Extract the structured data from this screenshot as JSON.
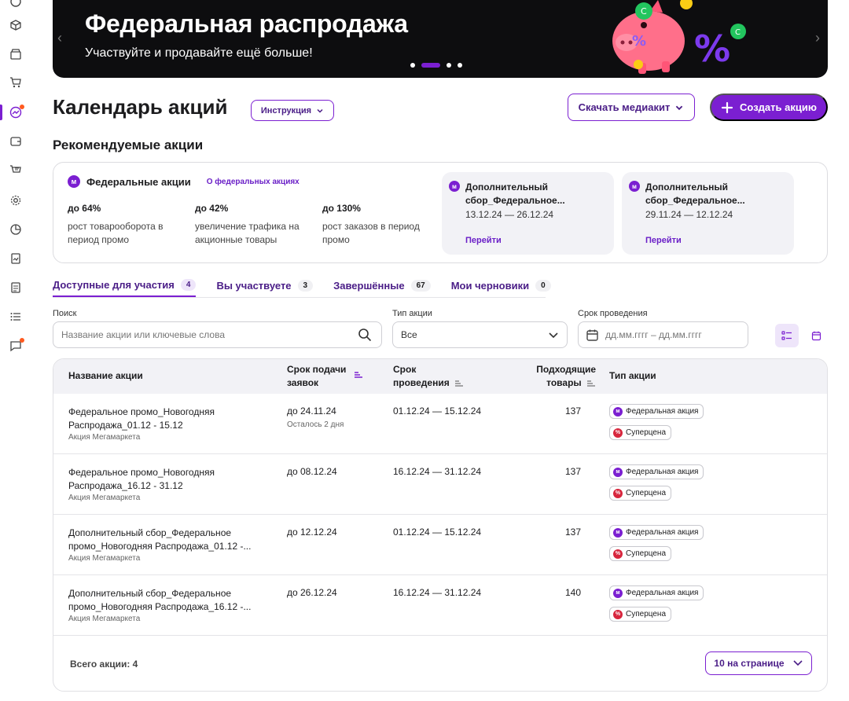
{
  "banner": {
    "title": "Федеральная распродажа",
    "subtitle": "Участвуйте и продавайте ещё больше!"
  },
  "header": {
    "title": "Календарь акций",
    "instruction_label": "Инструкция",
    "mediakit_label": "Скачать медиакит",
    "create_label": "Создать акцию"
  },
  "recommended": {
    "title": "Рекомендуемые акции",
    "logo_letter": "м",
    "federal_title": "Федеральные акции",
    "federal_link": "О федеральных акциях",
    "stats": [
      {
        "value": "до 64%",
        "desc": "рост товарооборота в период промо"
      },
      {
        "value": "до 42%",
        "desc": "увеличение трафика на акционные товары"
      },
      {
        "value": "до 130%",
        "desc": "рост заказов в период промо"
      }
    ],
    "cards": [
      {
        "title": "Дополнительный сбор_Федеральное...",
        "dates": "13.12.24 — 26.12.24",
        "link": "Перейти"
      },
      {
        "title": "Дополнительный сбор_Федеральное...",
        "dates": "29.11.24 — 12.12.24",
        "link": "Перейти"
      }
    ]
  },
  "tabs": [
    {
      "label": "Доступные для участия",
      "count": "4",
      "active": true
    },
    {
      "label": "Вы участвуете",
      "count": "3"
    },
    {
      "label": "Завершённые",
      "count": "67"
    },
    {
      "label": "Мои черновики",
      "count": "0"
    }
  ],
  "filters": {
    "search_label": "Поиск",
    "search_placeholder": "Название акции или ключевые слова",
    "type_label": "Тип акции",
    "type_value": "Все",
    "period_label": "Срок проведения",
    "period_placeholder": "дд.мм.гггг – дд.мм.гггг"
  },
  "table": {
    "headers": {
      "name": "Название акции",
      "deadline_1": "Срок подачи",
      "deadline_2": "заявок",
      "period_1": "Срок",
      "period_2": "проведения",
      "goods_1": "Подходящие",
      "goods_2": "товары",
      "type": "Тип акции"
    },
    "rows": [
      {
        "name": "Федеральное промо_Новогодняя Распродажа_01.12 - 15.12",
        "owner": "Акция Мегамаркета",
        "deadline": "до 24.11.24",
        "deadline_note": "Осталось 2 дня",
        "period": "01.12.24 — 15.12.24",
        "goods": "137",
        "badges": [
          "Федеральная акция",
          "Суперцена"
        ]
      },
      {
        "name": "Федеральное промо_Новогодняя Распродажа_16.12 - 31.12",
        "owner": "Акция Мегамаркета",
        "deadline": "до 08.12.24",
        "deadline_note": "",
        "period": "16.12.24 — 31.12.24",
        "goods": "137",
        "badges": [
          "Федеральная акция",
          "Суперцена"
        ]
      },
      {
        "name": "Дополнительный сбор_Федеральное промо_Новогодняя Распродажа_01.12 -...",
        "owner": "Акция Мегамаркета",
        "deadline": "до 12.12.24",
        "deadline_note": "",
        "period": "01.12.24 — 15.12.24",
        "goods": "137",
        "badges": [
          "Федеральная акция",
          "Суперцена"
        ]
      },
      {
        "name": "Дополнительный сбор_Федеральное промо_Новогодняя Распродажа_16.12 -...",
        "owner": "Акция Мегамаркета",
        "deadline": "до 26.12.24",
        "deadline_note": "",
        "period": "16.12.24 — 31.12.24",
        "goods": "140",
        "badges": [
          "Федеральная акция",
          "Суперцена"
        ]
      }
    ],
    "total": "Всего акции: 4",
    "per_page": "10 на странице"
  },
  "colors": {
    "accent": "#7b1fd1",
    "banner_bg": "#0d0d0f",
    "super_red": "#d7263d"
  }
}
